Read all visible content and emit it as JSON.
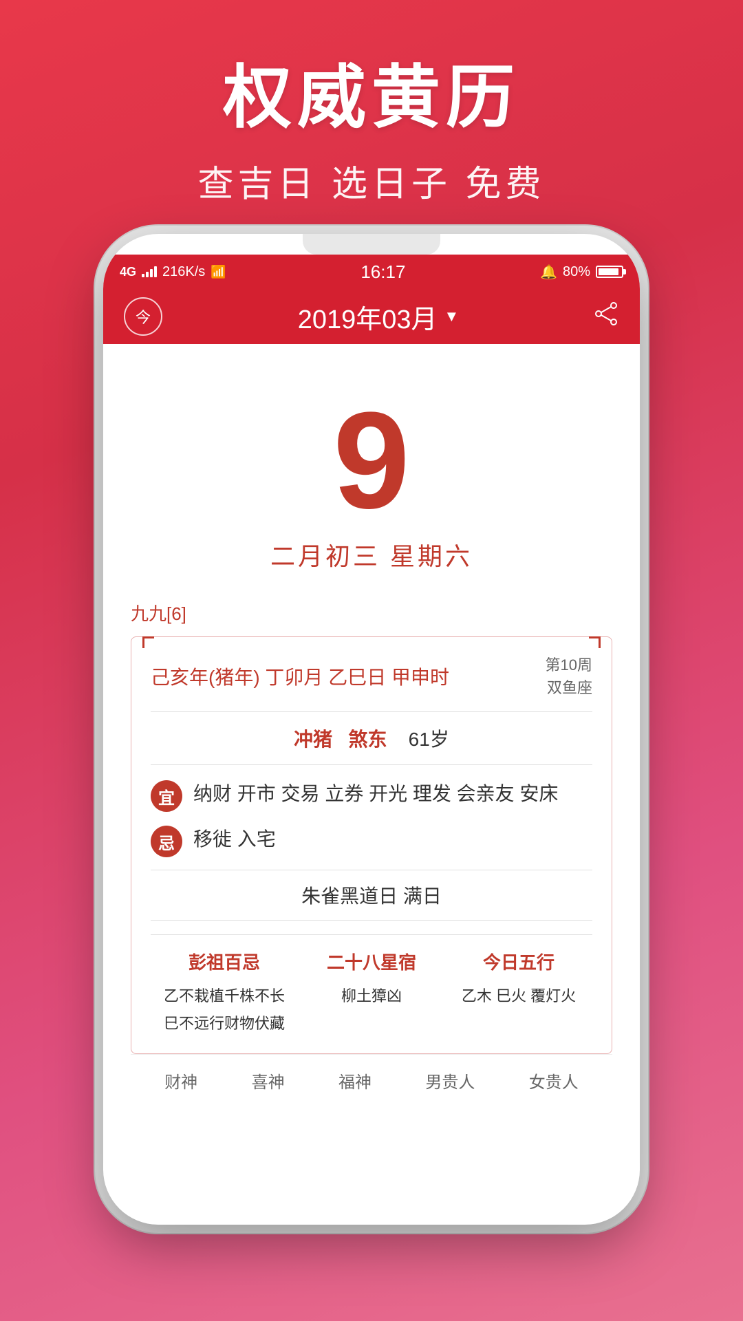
{
  "banner": {
    "main_title": "权威黄历",
    "sub_title": "查吉日 选日子 免费"
  },
  "status_bar": {
    "signal": "4G",
    "speed": "216K/s",
    "time": "16:17",
    "alarm": "🔔",
    "battery_percent": "80%"
  },
  "nav": {
    "today_label": "今",
    "month_title": "2019年03月",
    "dropdown_arrow": "▼"
  },
  "date": {
    "day_number": "9",
    "lunar_date": "二月初三  星期六"
  },
  "day_info": {
    "nine_badge": "九九[6]",
    "ganzhi": "己亥年(猪年) 丁卯月 乙巳日 甲申时",
    "week_label": "第10周",
    "zodiac": "双鱼座",
    "chong": "冲猪",
    "sha": "煞东",
    "age": "61岁",
    "yi_label": "宜",
    "yi_items": "纳财 开市 交易 立券 开光 理发 会亲友 安床",
    "ji_label": "忌",
    "ji_items": "移徙 入宅",
    "zhuque_row": "朱雀黑道日  满日",
    "col1_title": "彭祖百忌",
    "col1_line1": "乙不栽植千株不长",
    "col1_line2": "巳不远行财物伏藏",
    "col2_title": "二十八星宿",
    "col2_content": "柳土獐凶",
    "col3_title": "今日五行",
    "col3_content": "乙木 巳火 覆灯火"
  },
  "footer": {
    "items": [
      "财神",
      "喜神",
      "福神",
      "男贵人",
      "女贵人"
    ]
  }
}
